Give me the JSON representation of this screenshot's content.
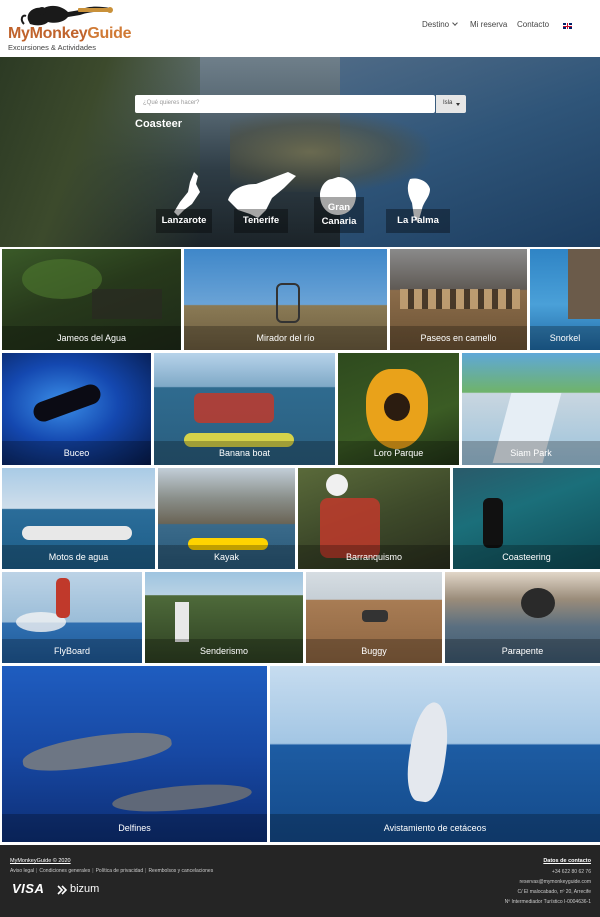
{
  "header": {
    "logo_part1": "MyMonkey",
    "logo_part2": "Guide",
    "logo_subtitle": "Excursiones & Actividades",
    "nav": {
      "destino": "Destino",
      "reserva": "Mi reserva",
      "contacto": "Contacto"
    },
    "language_flag": "uk-flag-icon"
  },
  "hero": {
    "search_placeholder": "¿Qué quieres hacer?",
    "island_select": "Isla",
    "overlay_word": "Coasteer",
    "islands": [
      {
        "label": "Lanzarote"
      },
      {
        "label": "Tenerife"
      },
      {
        "label": "Gran Canaria"
      },
      {
        "label": "La Palma"
      }
    ]
  },
  "activities": {
    "row1": [
      "Jameos del Agua",
      "Mirador del río",
      "Paseos en camello",
      "Snorkel"
    ],
    "row2": [
      "Buceo",
      "Banana boat",
      "Loro Parque",
      "Siam Park"
    ],
    "row3": [
      "Motos de agua",
      "Kayak",
      "Barranquismo",
      "Coasteering"
    ],
    "row4": [
      "FlyBoard",
      "Senderismo",
      "Buggy",
      "Parapente"
    ],
    "row5": [
      "Delfines",
      "Avistamiento de cetáceos"
    ]
  },
  "footer": {
    "copyright": "MyMonkeyGuide © 2020",
    "links": [
      "Aviso legal",
      "Condiciones generales",
      "Política de privacidad",
      "Reembolsos y cancelaciones"
    ],
    "payment_visa": "VISA",
    "payment_bizum": "bizum",
    "contact_title": "Datos de contacto",
    "phone": "+34 622 80 62 76",
    "email": "reservas@mymonkeyguide.com",
    "address": "C/ El malocabado, nº 20, Arrecife",
    "registry": "Nº Intermediador Turístico I-0004636-1"
  }
}
